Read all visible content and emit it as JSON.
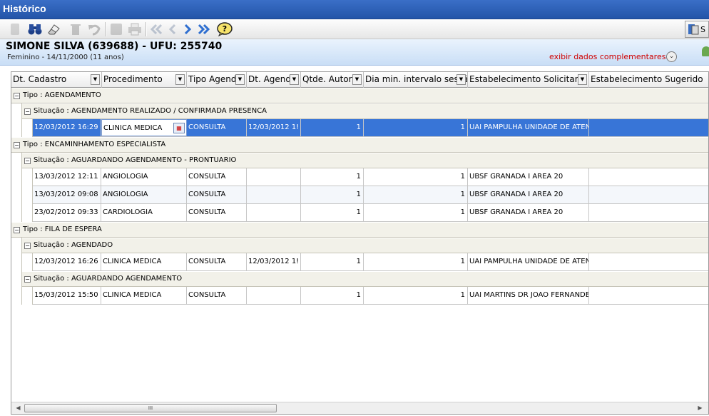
{
  "window": {
    "title": "Histórico"
  },
  "toolbar": {
    "right_button_label": "S"
  },
  "patient": {
    "name": "SIMONE SILVA (639688) - UFU: 255740",
    "info": "Feminino - 14/11/2000 (11 anos)",
    "more_link": "exibir dados complementares..."
  },
  "columns": [
    "Dt. Cadastro",
    "Procedimento",
    "Tipo Agend",
    "Dt. Agend",
    "Qtde. Autor",
    "Dia min. intervalo sessã",
    "Estabelecimento Solicitant",
    "Estabelecimento Sugerido"
  ],
  "groups": [
    {
      "label": "Tipo : AGENDAMENTO",
      "subgroups": [
        {
          "label": "Situação : AGENDAMENTO REALIZADO / CONFIRMADA PRESENCA",
          "rows": [
            {
              "dt_cadastro": "12/03/2012 16:29",
              "procedimento": "CLINICA MEDICA",
              "tipo": "CONSULTA",
              "dt_agend": "12/03/2012 1!",
              "qtde": "1",
              "dia_min": "1",
              "estab_sol": "UAI PAMPULHA UNIDADE DE ATEN",
              "estab_sug": "",
              "selected": true
            }
          ]
        }
      ]
    },
    {
      "label": "Tipo : ENCAMINHAMENTO ESPECIALISTA",
      "subgroups": [
        {
          "label": "Situação : AGUARDANDO AGENDAMENTO - PRONTUARIO",
          "rows": [
            {
              "dt_cadastro": "13/03/2012 12:11",
              "procedimento": "ANGIOLOGIA",
              "tipo": "CONSULTA",
              "dt_agend": "",
              "qtde": "1",
              "dia_min": "1",
              "estab_sol": "UBSF GRANADA I AREA 20",
              "estab_sug": ""
            },
            {
              "dt_cadastro": "13/03/2012 09:08",
              "procedimento": "ANGIOLOGIA",
              "tipo": "CONSULTA",
              "dt_agend": "",
              "qtde": "1",
              "dia_min": "1",
              "estab_sol": "UBSF GRANADA I AREA 20",
              "estab_sug": ""
            },
            {
              "dt_cadastro": "23/02/2012 09:33",
              "procedimento": "CARDIOLOGIA",
              "tipo": "CONSULTA",
              "dt_agend": "",
              "qtde": "1",
              "dia_min": "1",
              "estab_sol": "UBSF GRANADA I AREA 20",
              "estab_sug": ""
            }
          ]
        }
      ]
    },
    {
      "label": "Tipo : FILA DE ESPERA",
      "subgroups": [
        {
          "label": "Situação : AGENDADO",
          "rows": [
            {
              "dt_cadastro": "12/03/2012 16:26",
              "procedimento": "CLINICA MEDICA",
              "tipo": "CONSULTA",
              "dt_agend": "12/03/2012 1!",
              "qtde": "1",
              "dia_min": "1",
              "estab_sol": "UAI PAMPULHA UNIDADE DE ATEN",
              "estab_sug": ""
            }
          ]
        },
        {
          "label": "Situação : AGUARDANDO AGENDAMENTO",
          "rows": [
            {
              "dt_cadastro": "15/03/2012 15:50",
              "procedimento": "CLINICA MEDICA",
              "tipo": "CONSULTA",
              "dt_agend": "",
              "qtde": "1",
              "dia_min": "1",
              "estab_sol": "UAI MARTINS DR JOAO FERNANDES",
              "estab_sug": ""
            }
          ]
        }
      ]
    }
  ],
  "scrollbar": {
    "thumb_label": "III"
  },
  "colors": {
    "title_bar": "#2c5fb5",
    "selected_row": "#3875d7",
    "link": "#d00000"
  }
}
